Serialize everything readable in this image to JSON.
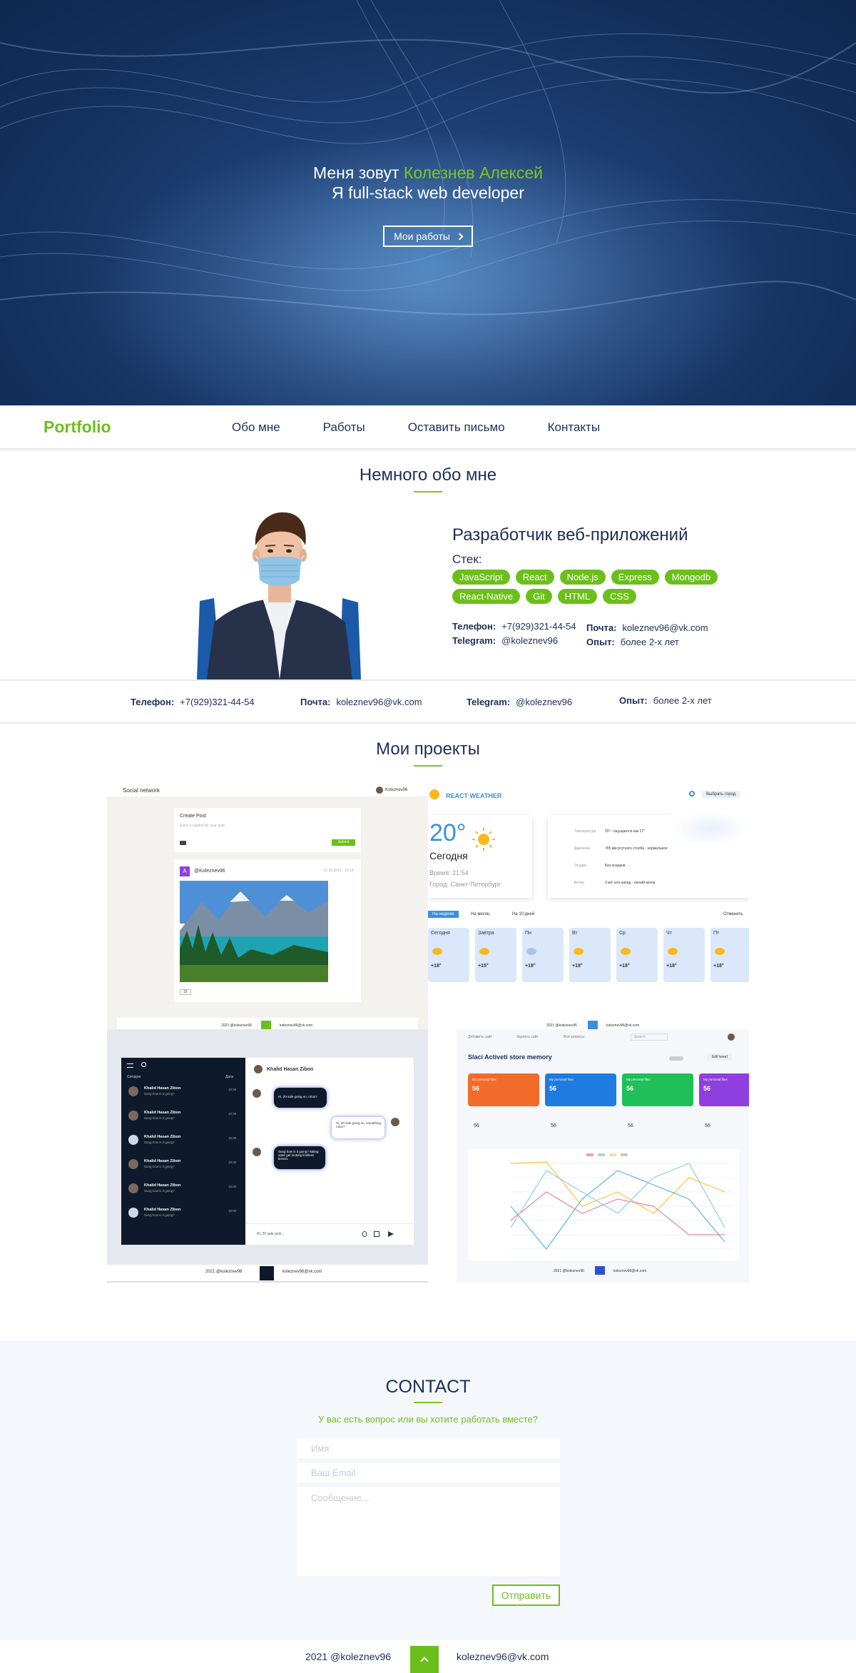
{
  "hero": {
    "greeting": "Меня зовут",
    "name": "Колезнев Алексей",
    "subtitle": "Я full-stack web developer",
    "button": "Мои работы"
  },
  "nav": {
    "logo": "Portfolio",
    "items": [
      "Обо мне",
      "Работы",
      "Оставить письмо",
      "Контакты"
    ]
  },
  "about": {
    "title": "Немного обо мне",
    "role": "Разработчик веб-приложений",
    "stack_label": "Стек:",
    "stack": [
      "JavaScript",
      "React",
      "Node.js",
      "Express",
      "Mongodb",
      "React-Native",
      "Git",
      "HTML",
      "CSS"
    ],
    "phone_label": "Телефон:",
    "phone": "+7(929)321-44-54",
    "telegram_label": "Telegram:",
    "telegram": "@koleznev96",
    "email_label": "Почта:",
    "email": "koleznev96@vk.com",
    "exp_label": "Опыт:",
    "exp": "более 2-х лет"
  },
  "strip": {
    "phone_label": "Телефон:",
    "phone": "+7(929)321-44-54",
    "email_label": "Почта:",
    "email": "koleznev96@vk.com",
    "telegram_label": "Telegram:",
    "telegram": "@koleznev96",
    "exp_label": "Опыт:",
    "exp": "более 2-х лет"
  },
  "projects": {
    "title": "Мои проекты",
    "social": {
      "app": "Social network",
      "user": "Koleznev96",
      "create": "Create Post",
      "placeholder": "Enter a caption for your post",
      "submit": "Submit",
      "author": "@Koleznev96",
      "date": "11.10.2021 · 22:14",
      "likes": "15",
      "footer_left": "2021 @koleznev96",
      "footer_right": "koleznev96@vk.com"
    },
    "weather": {
      "brand": "REACT WEATHER",
      "select": "Выбрать город",
      "temp": "20°",
      "today": "Сегодня",
      "time": "Время: 21:54",
      "city": "Город: Санкт-Петербург",
      "details": [
        {
          "label": "Температура",
          "value": "20° - ощущается как 17°"
        },
        {
          "label": "Давление",
          "value": "765 мм ртутного столба - нормальное"
        },
        {
          "label": "Осадки",
          "value": "Без осадков"
        },
        {
          "label": "Ветер",
          "value": "3 м/с юго-запад - легкий ветер"
        }
      ],
      "tabs": [
        "На неделю",
        "На месяц",
        "На 10 дней"
      ],
      "cancel": "Отменить",
      "days": [
        {
          "d": "Сегодня",
          "t": "+18°"
        },
        {
          "d": "Завтра",
          "t": "+15°"
        },
        {
          "d": "Пн",
          "t": "+18°"
        },
        {
          "d": "Вт",
          "t": "+18°"
        },
        {
          "d": "Ср",
          "t": "+18°"
        },
        {
          "d": "Чт",
          "t": "+18°"
        },
        {
          "d": "Пт",
          "t": "+18°"
        }
      ],
      "footer_left": "2021 @koleznev96",
      "footer_right": "koleznev96@vk.com"
    },
    "chat": {
      "filter": "Сегодня",
      "sort": "Дата",
      "contact": "Khalid Hasan Zibon",
      "preview": "Sung how is it going?",
      "time": "10:30",
      "msg1": "Hi, 20 sale going on, rubio?",
      "msg2": "Hi, 20 sale going on, something rubio?",
      "msg3": "Sung how is it going? Sitting sater get looking limitless lesson.",
      "input": "Hi, 20 sale goin...",
      "footer_left": "2021 @koleznev96",
      "footer_right": "koleznev96@vk.com"
    },
    "dashboard": {
      "top": [
        "Добавить сайт",
        "Удалить сайт",
        "Все катресы"
      ],
      "search": "Search",
      "title": "Slaci Activeti store memory",
      "edit": "Edit tweet",
      "card_title": "My personal files",
      "card_value": "56",
      "card_colors": [
        "#f26b2a",
        "#1e7be0",
        "#1fbf5a",
        "#8f3fe0"
      ],
      "footer_left": "2021 @koleznev96",
      "footer_right": "koleznev96@vk.com"
    }
  },
  "contact": {
    "title": "CONTACT",
    "subtitle": "У вас есть вопрос или вы хотите работать вместе?",
    "name_placeholder": "Имя",
    "email_placeholder": "Ваш Email",
    "message_placeholder": "Сообщение...",
    "send": "Отправить"
  },
  "footer": {
    "left": "2021 @koleznev96",
    "right": "koleznev96@vk.com"
  },
  "colors": {
    "accent": "#6cbf1a",
    "navy": "#1c2f57",
    "hero_bg": "#14305e"
  }
}
